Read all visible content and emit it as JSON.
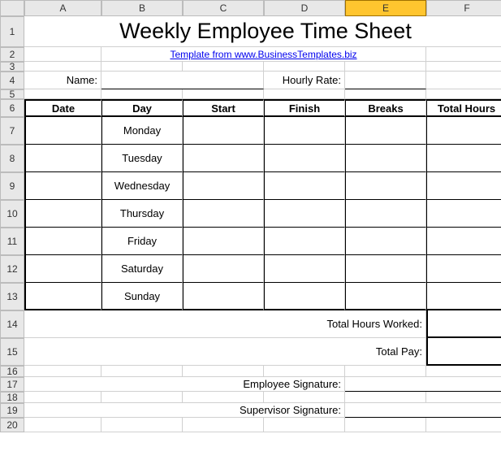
{
  "columns": [
    "A",
    "B",
    "C",
    "D",
    "E",
    "F"
  ],
  "selected_column": "E",
  "rows": [
    "1",
    "2",
    "3",
    "4",
    "5",
    "6",
    "7",
    "8",
    "9",
    "10",
    "11",
    "12",
    "13",
    "14",
    "15",
    "16",
    "17",
    "18",
    "19",
    "20"
  ],
  "row_heights": {
    "1": 38,
    "2": 18,
    "3": 12,
    "4": 22,
    "5": 12,
    "6": 22,
    "7": 34,
    "8": 34,
    "9": 34,
    "10": 34,
    "11": 34,
    "12": 34,
    "13": 34,
    "14": 34,
    "15": 34,
    "16": 14,
    "17": 18,
    "18": 14,
    "19": 18,
    "20": 18
  },
  "title": "Weekly Employee Time Sheet",
  "link_text": "Template from www.BusinessTemplates.biz",
  "labels": {
    "name": "Name:",
    "hourly_rate": "Hourly Rate:",
    "total_hours_worked": "Total Hours Worked:",
    "total_pay": "Total Pay:",
    "employee_signature": "Employee Signature:",
    "supervisor_signature": "Supervisor Signature:"
  },
  "table": {
    "headers": [
      "Date",
      "Day",
      "Start",
      "Finish",
      "Breaks",
      "Total Hours"
    ],
    "days": [
      "Monday",
      "Tuesday",
      "Wednesday",
      "Thursday",
      "Friday",
      "Saturday",
      "Sunday"
    ]
  },
  "inputs": {
    "name": "",
    "hourly_rate": "",
    "total_hours_worked": "",
    "total_pay": ""
  }
}
